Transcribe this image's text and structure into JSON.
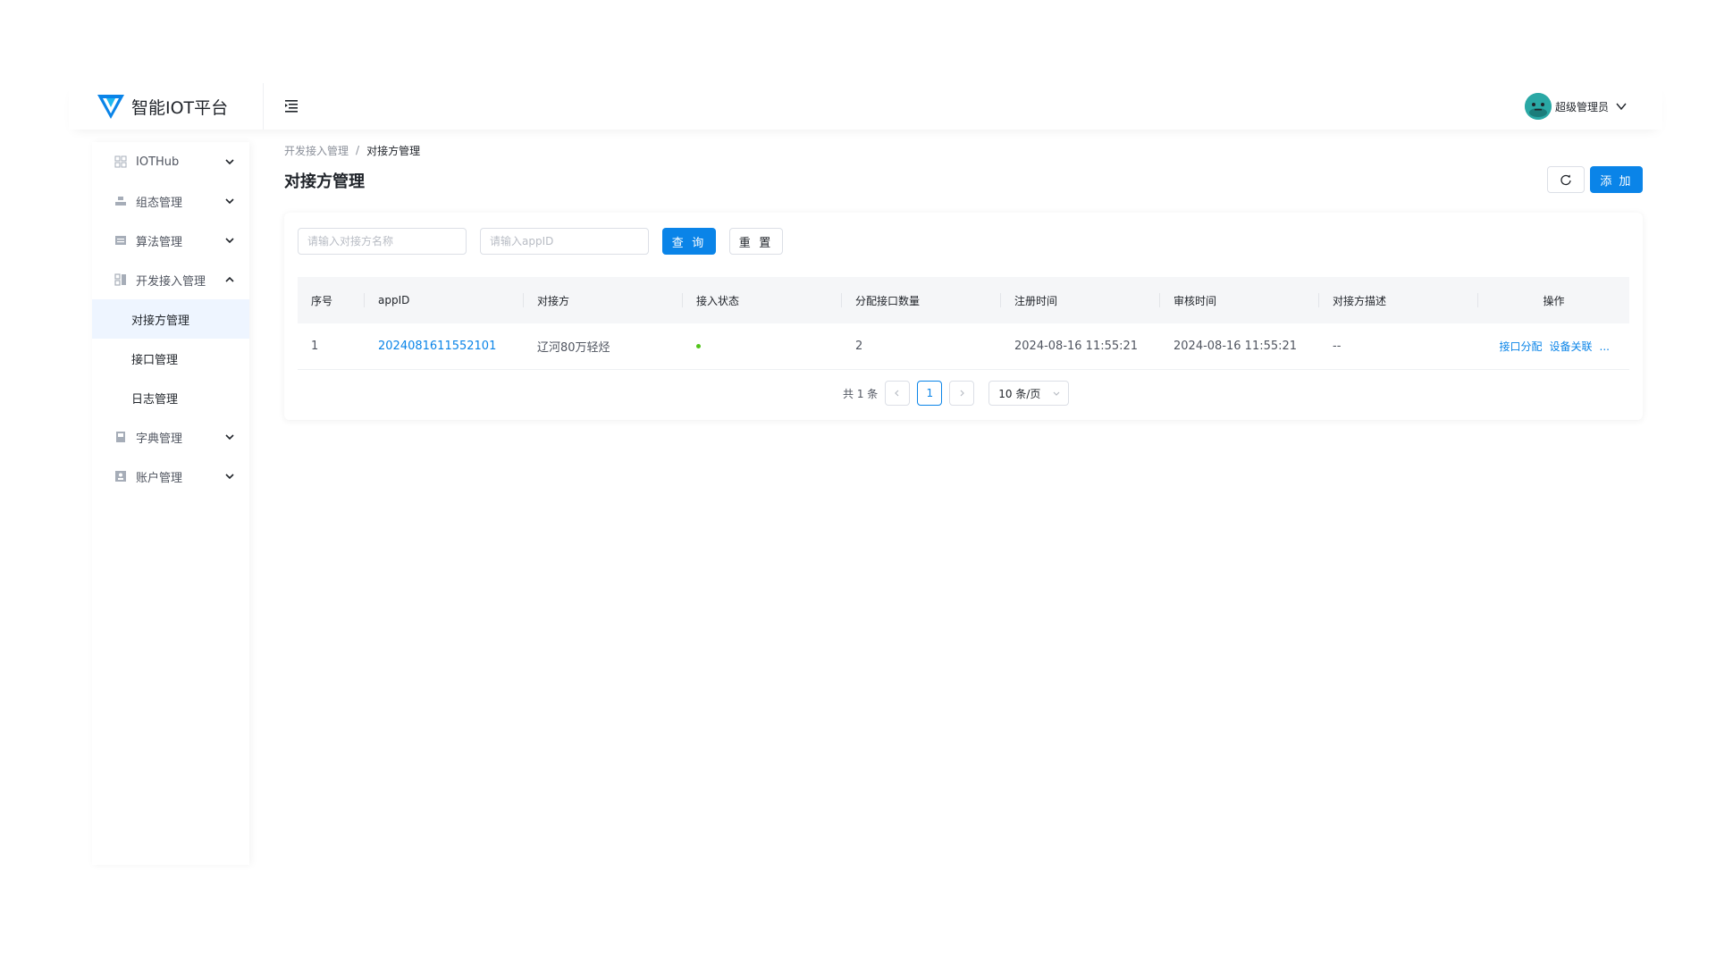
{
  "header": {
    "app_title": "智能IOT平台",
    "user_name": "超级管理员"
  },
  "sidebar": {
    "items": [
      {
        "label": "IOTHub",
        "icon": "grid-icon",
        "expanded": false
      },
      {
        "label": "组态管理",
        "icon": "config-icon",
        "expanded": false
      },
      {
        "label": "算法管理",
        "icon": "algorithm-icon",
        "expanded": false
      },
      {
        "label": "开发接入管理",
        "icon": "dev-access-icon",
        "expanded": true
      },
      {
        "label": "字典管理",
        "icon": "dictionary-icon",
        "expanded": false
      },
      {
        "label": "账户管理",
        "icon": "account-icon",
        "expanded": false
      }
    ],
    "sub_items": [
      {
        "label": "对接方管理",
        "active": true
      },
      {
        "label": "接口管理",
        "active": false
      },
      {
        "label": "日志管理",
        "active": false
      }
    ]
  },
  "breadcrumb": {
    "parent": "开发接入管理",
    "separator": "/",
    "current": "对接方管理"
  },
  "page": {
    "title": "对接方管理",
    "add_label": "添 加"
  },
  "filters": {
    "name_placeholder": "请输入对接方名称",
    "appid_placeholder": "请输入appID",
    "query_label": "查 询",
    "reset_label": "重 置"
  },
  "table": {
    "columns": [
      "序号",
      "appID",
      "对接方",
      "接入状态",
      "分配接口数量",
      "注册时间",
      "审核时间",
      "对接方描述",
      "操作"
    ],
    "rows": [
      {
        "index": "1",
        "appid": "2024081611552101",
        "party": "辽河80万轻烃",
        "status": "online",
        "interface_count": "2",
        "register_time": "2024-08-16 11:55:21",
        "review_time": "2024-08-16 11:55:21",
        "description": "--",
        "actions": [
          "接口分配",
          "设备关联",
          "..."
        ]
      }
    ]
  },
  "pagination": {
    "total_label": "共 1 条",
    "current_page": "1",
    "page_size_label": "10 条/页"
  },
  "colors": {
    "primary": "#0a84e8",
    "status_online": "#52c41a"
  }
}
